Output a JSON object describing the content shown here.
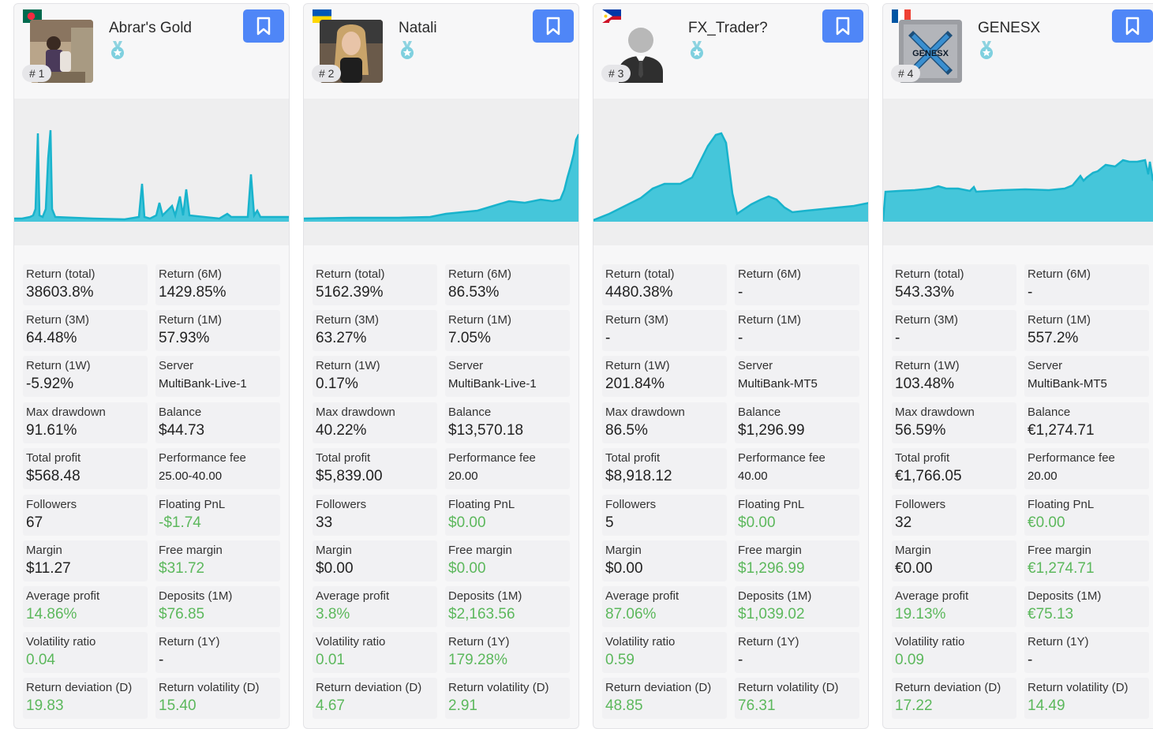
{
  "colors": {
    "accent": "#4f86f7",
    "chart_fill": "#45c6da",
    "chart_line": "#19b3cc",
    "positive": "#5cb85c"
  },
  "traders": [
    {
      "name": "Abrar's Gold",
      "rank": "# 1",
      "flag": "bangladesh-flag",
      "stats": [
        {
          "label": "Return (total)",
          "value": "38603.8%"
        },
        {
          "label": "Return (6M)",
          "value": "1429.85%"
        },
        {
          "label": "Return (3M)",
          "value": "64.48%"
        },
        {
          "label": "Return (1M)",
          "value": "57.93%"
        },
        {
          "label": "Return (1W)",
          "value": "-5.92%"
        },
        {
          "label": "Server",
          "value": "MultiBank-Live-1"
        },
        {
          "label": "Max drawdown",
          "value": "91.61%"
        },
        {
          "label": "Balance",
          "value": "$44.73"
        },
        {
          "label": "Total profit",
          "value": "$568.48"
        },
        {
          "label": "Performance fee",
          "value": "25.00-40.00"
        },
        {
          "label": "Followers",
          "value": "67"
        },
        {
          "label": "Floating PnL",
          "value": "-$1.74"
        },
        {
          "label": "Margin",
          "value": "$11.27"
        },
        {
          "label": "Free margin",
          "value": "$31.72"
        },
        {
          "label": "Average profit",
          "value": "14.86%"
        },
        {
          "label": "Deposits (1M)",
          "value": "$76.85"
        },
        {
          "label": "Volatility ratio",
          "value": "0.04"
        },
        {
          "label": "Return (1Y)",
          "value": "-"
        },
        {
          "label": "Return deviation (D)",
          "value": "19.83"
        },
        {
          "label": "Return volatility (D)",
          "value": "15.40"
        }
      ]
    },
    {
      "name": "Natali",
      "rank": "# 2",
      "flag": "ukraine-flag",
      "stats": [
        {
          "label": "Return (total)",
          "value": "5162.39%"
        },
        {
          "label": "Return (6M)",
          "value": "86.53%"
        },
        {
          "label": "Return (3M)",
          "value": "63.27%"
        },
        {
          "label": "Return (1M)",
          "value": "7.05%"
        },
        {
          "label": "Return (1W)",
          "value": "0.17%"
        },
        {
          "label": "Server",
          "value": "MultiBank-Live-1"
        },
        {
          "label": "Max drawdown",
          "value": "40.22%"
        },
        {
          "label": "Balance",
          "value": "$13,570.18"
        },
        {
          "label": "Total profit",
          "value": "$5,839.00"
        },
        {
          "label": "Performance fee",
          "value": "20.00"
        },
        {
          "label": "Followers",
          "value": "33"
        },
        {
          "label": "Floating PnL",
          "value": "$0.00"
        },
        {
          "label": "Margin",
          "value": "$0.00"
        },
        {
          "label": "Free margin",
          "value": "$0.00"
        },
        {
          "label": "Average profit",
          "value": "3.8%"
        },
        {
          "label": "Deposits (1M)",
          "value": "$2,163.56"
        },
        {
          "label": "Volatility ratio",
          "value": "0.01"
        },
        {
          "label": "Return (1Y)",
          "value": "179.28%"
        },
        {
          "label": "Return deviation (D)",
          "value": "4.67"
        },
        {
          "label": "Return volatility (D)",
          "value": "2.91"
        }
      ]
    },
    {
      "name": "FX_Trader?",
      "rank": "# 3",
      "flag": "philippines-flag",
      "stats": [
        {
          "label": "Return (total)",
          "value": "4480.38%"
        },
        {
          "label": "Return (6M)",
          "value": "-"
        },
        {
          "label": "Return (3M)",
          "value": "-"
        },
        {
          "label": "Return (1M)",
          "value": "-"
        },
        {
          "label": "Return (1W)",
          "value": "201.84%"
        },
        {
          "label": "Server",
          "value": "MultiBank-MT5"
        },
        {
          "label": "Max drawdown",
          "value": "86.5%"
        },
        {
          "label": "Balance",
          "value": "$1,296.99"
        },
        {
          "label": "Total profit",
          "value": "$8,918.12"
        },
        {
          "label": "Performance fee",
          "value": "40.00"
        },
        {
          "label": "Followers",
          "value": "5"
        },
        {
          "label": "Floating PnL",
          "value": "$0.00"
        },
        {
          "label": "Margin",
          "value": "$0.00"
        },
        {
          "label": "Free margin",
          "value": "$1,296.99"
        },
        {
          "label": "Average profit",
          "value": "87.06%"
        },
        {
          "label": "Deposits (1M)",
          "value": "$1,039.02"
        },
        {
          "label": "Volatility ratio",
          "value": "0.59"
        },
        {
          "label": "Return (1Y)",
          "value": "-"
        },
        {
          "label": "Return deviation (D)",
          "value": "48.85"
        },
        {
          "label": "Return volatility (D)",
          "value": "76.31"
        }
      ]
    },
    {
      "name": "GENESX",
      "rank": "# 4",
      "flag": "france-flag",
      "stats": [
        {
          "label": "Return (total)",
          "value": "543.33%"
        },
        {
          "label": "Return (6M)",
          "value": "-"
        },
        {
          "label": "Return (3M)",
          "value": "-"
        },
        {
          "label": "Return (1M)",
          "value": "557.2%"
        },
        {
          "label": "Return (1W)",
          "value": "103.48%"
        },
        {
          "label": "Server",
          "value": "MultiBank-MT5"
        },
        {
          "label": "Max drawdown",
          "value": "56.59%"
        },
        {
          "label": "Balance",
          "value": "€1,274.71"
        },
        {
          "label": "Total profit",
          "value": "€1,766.05"
        },
        {
          "label": "Performance fee",
          "value": "20.00"
        },
        {
          "label": "Followers",
          "value": "32"
        },
        {
          "label": "Floating PnL",
          "value": "€0.00"
        },
        {
          "label": "Margin",
          "value": "€0.00"
        },
        {
          "label": "Free margin",
          "value": "€1,274.71"
        },
        {
          "label": "Average profit",
          "value": "19.13%"
        },
        {
          "label": "Deposits (1M)",
          "value": "€75.13"
        },
        {
          "label": "Volatility ratio",
          "value": "0.09"
        },
        {
          "label": "Return (1Y)",
          "value": "-"
        },
        {
          "label": "Return deviation (D)",
          "value": "17.22"
        },
        {
          "label": "Return volatility (D)",
          "value": "14.49"
        }
      ]
    }
  ]
}
